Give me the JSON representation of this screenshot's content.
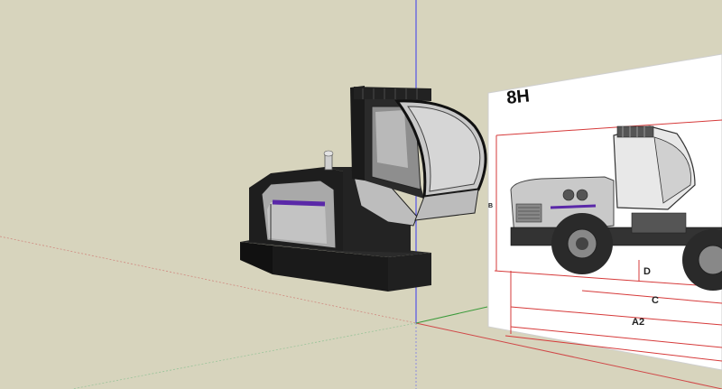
{
  "scene": {
    "background_color": "#d7d4bd",
    "axis_colors": {
      "blue": "#3a3af0",
      "red": "#d04848",
      "green": "#3a9a3a"
    }
  },
  "model": {
    "description_icon": "vehicle-cab-model",
    "accent_color": "#5a28a8",
    "body_dark": "#222222",
    "body_gray": "#a9a9a9"
  },
  "reference_image": {
    "title": "8H",
    "dimension_labels": {
      "d": "D",
      "c": "C",
      "a2": "A2",
      "b": "B"
    },
    "line_color": "#d63a3a"
  }
}
